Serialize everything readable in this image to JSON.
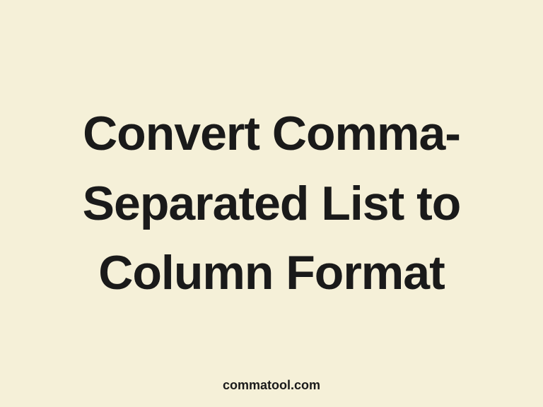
{
  "heading": "Convert Comma-Separated List to Column Format",
  "footer": "commatool.com"
}
